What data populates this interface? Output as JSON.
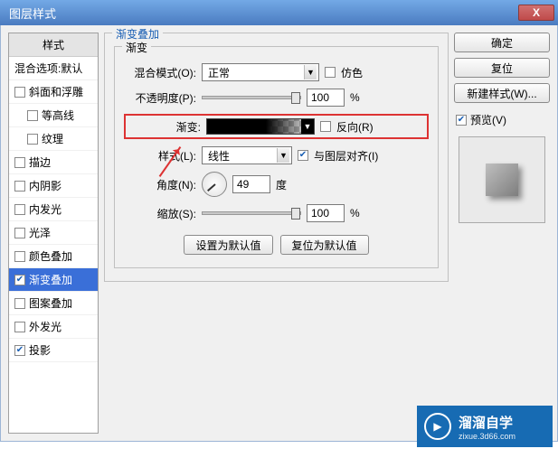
{
  "window": {
    "title": "图层样式",
    "close": "X"
  },
  "left": {
    "header": "样式",
    "sub": "混合选项:默认",
    "items": [
      {
        "label": "斜面和浮雕",
        "checked": false,
        "indent": false
      },
      {
        "label": "等高线",
        "checked": false,
        "indent": true
      },
      {
        "label": "纹理",
        "checked": false,
        "indent": true
      },
      {
        "label": "描边",
        "checked": false,
        "indent": false
      },
      {
        "label": "内阴影",
        "checked": false,
        "indent": false
      },
      {
        "label": "内发光",
        "checked": false,
        "indent": false
      },
      {
        "label": "光泽",
        "checked": false,
        "indent": false
      },
      {
        "label": "颜色叠加",
        "checked": false,
        "indent": false
      },
      {
        "label": "渐变叠加",
        "checked": true,
        "indent": false,
        "selected": true
      },
      {
        "label": "图案叠加",
        "checked": false,
        "indent": false
      },
      {
        "label": "外发光",
        "checked": false,
        "indent": false
      },
      {
        "label": "投影",
        "checked": true,
        "indent": false
      }
    ]
  },
  "mid": {
    "group_title": "渐变叠加",
    "inner_title": "渐变",
    "blend_label": "混合模式(O):",
    "blend_value": "正常",
    "dither_label": "仿色",
    "opacity_label": "不透明度(P):",
    "opacity_value": "100",
    "percent": "%",
    "gradient_label": "渐变:",
    "reverse_label": "反向(R)",
    "style_label": "样式(L):",
    "style_value": "线性",
    "align_label": "与图层对齐(I)",
    "angle_label": "角度(N):",
    "angle_value": "49",
    "angle_unit": "度",
    "scale_label": "缩放(S):",
    "scale_value": "100",
    "set_default": "设置为默认值",
    "reset_default": "复位为默认值"
  },
  "right": {
    "ok": "确定",
    "reset": "复位",
    "newstyle": "新建样式(W)...",
    "preview": "预览(V)"
  },
  "watermark": {
    "brand": "溜溜自学",
    "site": "zixue.3d66.com"
  }
}
